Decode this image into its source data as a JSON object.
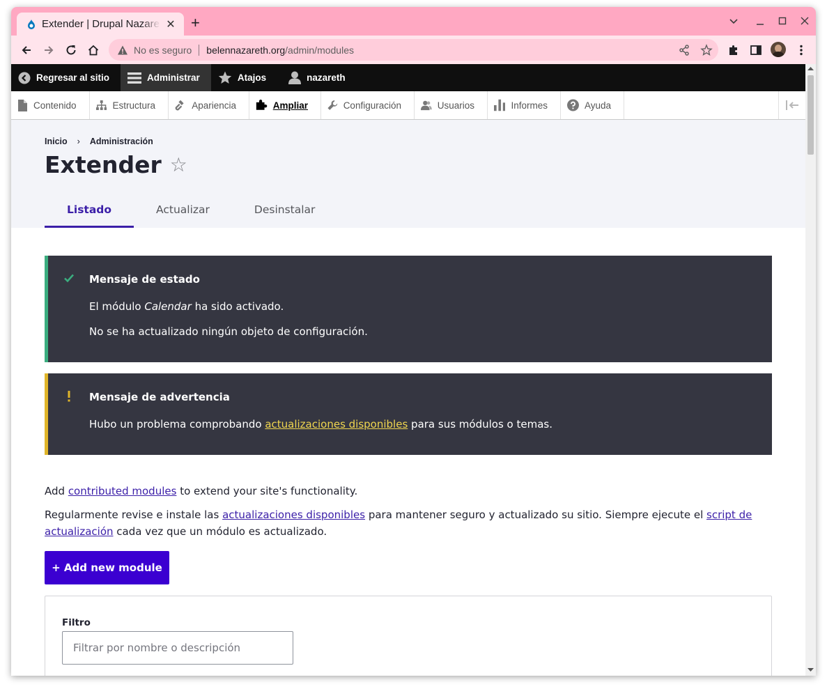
{
  "browser": {
    "tab_title": "Extender | Drupal Nazareth",
    "new_tab": "+",
    "not_secure": "No es seguro",
    "url_domain": "belennazareth.org",
    "url_path": "/admin/modules"
  },
  "admin_toolbar": {
    "items": [
      {
        "label": "Regresar al sitio",
        "icon": "back-arrow-icon"
      },
      {
        "label": "Administrar",
        "icon": "hamburger-menu-icon"
      },
      {
        "label": "Atajos",
        "icon": "star-icon"
      },
      {
        "label": "nazareth",
        "icon": "user-icon"
      }
    ],
    "tray": [
      {
        "label": "Contenido",
        "icon": "file-icon"
      },
      {
        "label": "Estructura",
        "icon": "structure-icon"
      },
      {
        "label": "Apariencia",
        "icon": "paintbrush-icon"
      },
      {
        "label": "Ampliar",
        "icon": "puzzle-icon"
      },
      {
        "label": "Configuración",
        "icon": "wrench-icon"
      },
      {
        "label": "Usuarios",
        "icon": "people-icon"
      },
      {
        "label": "Informes",
        "icon": "bar-chart-icon"
      },
      {
        "label": "Ayuda",
        "icon": "help-icon"
      }
    ]
  },
  "page": {
    "breadcrumb": [
      "Inicio",
      "Administración"
    ],
    "breadcrumb_sep": "›",
    "title": "Extender",
    "favorite_star": "☆",
    "tabs": [
      {
        "label": "Listado",
        "active": true
      },
      {
        "label": "Actualizar",
        "active": false
      },
      {
        "label": "Desinstalar",
        "active": false
      }
    ]
  },
  "messages": {
    "status": {
      "title": "Mensaje de estado",
      "line1_prefix": "El módulo ",
      "line1_module": "Calendar",
      "line1_suffix": " ha sido activado.",
      "line2": "No se ha actualizado ningún objeto de configuración.",
      "color": "#3bad7f"
    },
    "warning": {
      "title": "Mensaje de advertencia",
      "line_prefix": "Hubo un problema comprobando ",
      "line_link": "actualizaciones disponibles",
      "line_suffix": " para sus módulos o temas.",
      "color": "#e0b52a"
    }
  },
  "intro": {
    "p1_prefix": "Add ",
    "p1_link": "contributed modules",
    "p1_suffix": " to extend your site's functionality.",
    "p2_prefix": "Regularmente revise e instale las ",
    "p2_link1": "actualizaciones disponibles",
    "p2_middle": " para mantener seguro y actualizado su sitio. Siempre ejecute el ",
    "p2_link2": "script de actualización",
    "p2_suffix": " cada vez que un módulo es actualizado."
  },
  "add_button": "+ Add new module",
  "filter": {
    "label": "Filtro",
    "placeholder": "Filtrar por nombre o descripción",
    "value": ""
  },
  "colors": {
    "accent": "#3b00d1",
    "tab_strip": "#ffa8c2",
    "toolbar_bg": "#0f0f0f",
    "message_bg": "#353641"
  }
}
